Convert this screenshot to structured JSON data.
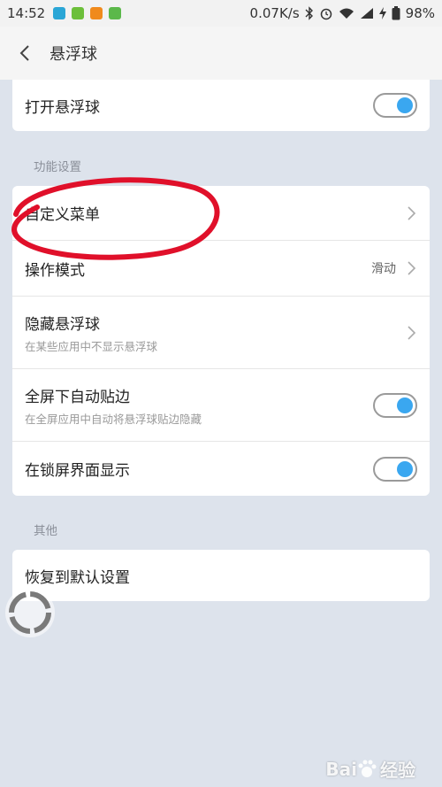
{
  "status_bar": {
    "time": "14:52",
    "net_speed": "0.07K/s",
    "battery": "98%",
    "icons": [
      "usb-icon",
      "sim-icon",
      "app-icon",
      "android-icon",
      "bluetooth-icon",
      "alarm-icon",
      "wifi-icon",
      "signal-icon",
      "charging-icon",
      "battery-icon"
    ]
  },
  "header": {
    "title": "悬浮球"
  },
  "top_card": {
    "open_label": "打开悬浮球",
    "open_toggle": true
  },
  "section_function": {
    "label": "功能设置",
    "items": [
      {
        "label": "自定义菜单",
        "sub": "",
        "value": "",
        "control": "chevron"
      },
      {
        "label": "操作模式",
        "sub": "",
        "value": "滑动",
        "control": "chevron"
      },
      {
        "label": "隐藏悬浮球",
        "sub": "在某些应用中不显示悬浮球",
        "value": "",
        "control": "chevron"
      },
      {
        "label": "全屏下自动贴边",
        "sub": "在全屏应用中自动将悬浮球贴边隐藏",
        "value": "",
        "control": "toggle",
        "on": true
      },
      {
        "label": "在锁屏界面显示",
        "sub": "",
        "value": "",
        "control": "toggle",
        "on": true
      }
    ]
  },
  "section_other": {
    "label": "其他",
    "reset_label": "恢复到默认设置"
  },
  "watermark": {
    "text_a": "Bai",
    "text_b": "经验"
  },
  "colors": {
    "accent": "#3aa7f0",
    "background": "#dde3ec",
    "annotation": "#e0102a"
  }
}
